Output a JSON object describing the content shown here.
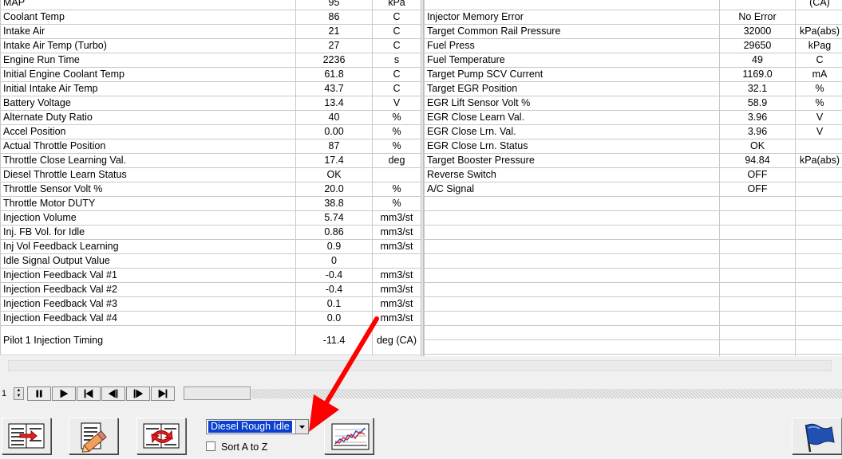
{
  "left_rows": [
    {
      "name": "MAP",
      "value": "95",
      "unit": "kPa"
    },
    {
      "name": "Coolant Temp",
      "value": "86",
      "unit": "C"
    },
    {
      "name": "Intake Air",
      "value": "21",
      "unit": "C"
    },
    {
      "name": "Intake Air Temp (Turbo)",
      "value": "27",
      "unit": "C"
    },
    {
      "name": "Engine Run Time",
      "value": "2236",
      "unit": "s"
    },
    {
      "name": "Initial Engine Coolant Temp",
      "value": "61.8",
      "unit": "C"
    },
    {
      "name": "Initial Intake Air Temp",
      "value": "43.7",
      "unit": "C"
    },
    {
      "name": "Battery Voltage",
      "value": "13.4",
      "unit": "V"
    },
    {
      "name": "Alternate Duty Ratio",
      "value": "40",
      "unit": "%"
    },
    {
      "name": "Accel Position",
      "value": "0.00",
      "unit": "%"
    },
    {
      "name": "Actual Throttle Position",
      "value": "87",
      "unit": "%"
    },
    {
      "name": "Throttle Close Learning Val.",
      "value": "17.4",
      "unit": "deg"
    },
    {
      "name": "Diesel Throttle Learn Status",
      "value": "OK",
      "unit": ""
    },
    {
      "name": "Throttle Sensor Volt %",
      "value": "20.0",
      "unit": "%"
    },
    {
      "name": "Throttle Motor DUTY",
      "value": "38.8",
      "unit": "%"
    },
    {
      "name": "Injection Volume",
      "value": "5.74",
      "unit": "mm3/st"
    },
    {
      "name": "Inj. FB Vol. for Idle",
      "value": "0.86",
      "unit": "mm3/st"
    },
    {
      "name": "Inj Vol Feedback Learning",
      "value": "0.9",
      "unit": "mm3/st"
    },
    {
      "name": "Idle Signal Output Value",
      "value": "0",
      "unit": ""
    },
    {
      "name": "Injection Feedback Val #1",
      "value": "-0.4",
      "unit": "mm3/st"
    },
    {
      "name": "Injection Feedback Val #2",
      "value": "-0.4",
      "unit": "mm3/st"
    },
    {
      "name": "Injection Feedback Val #3",
      "value": "0.1",
      "unit": "mm3/st"
    },
    {
      "name": "Injection Feedback Val #4",
      "value": "0.0",
      "unit": "mm3/st"
    },
    {
      "name": "Pilot 1 Injection Timing",
      "value": "-11.4",
      "unit": "deg (CA)"
    }
  ],
  "right_rows": [
    {
      "name": "",
      "value": "",
      "unit": "(CA)"
    },
    {
      "name": "Injector Memory Error",
      "value": "No Error",
      "unit": ""
    },
    {
      "name": "Target Common Rail Pressure",
      "value": "32000",
      "unit": "kPa(abs)"
    },
    {
      "name": "Fuel Press",
      "value": "29650",
      "unit": "kPag"
    },
    {
      "name": "Fuel Temperature",
      "value": "49",
      "unit": "C"
    },
    {
      "name": "Target Pump SCV Current",
      "value": "1169.0",
      "unit": "mA"
    },
    {
      "name": "Target EGR Position",
      "value": "32.1",
      "unit": "%"
    },
    {
      "name": "EGR Lift Sensor Volt %",
      "value": "58.9",
      "unit": "%"
    },
    {
      "name": "EGR Close Learn Val.",
      "value": "3.96",
      "unit": "V"
    },
    {
      "name": "EGR Close Lrn. Val.",
      "value": "3.96",
      "unit": "V"
    },
    {
      "name": "EGR Close Lrn. Status",
      "value": "OK",
      "unit": ""
    },
    {
      "name": "Target Booster Pressure",
      "value": "94.84",
      "unit": "kPa(abs)"
    },
    {
      "name": "Reverse Switch",
      "value": "OFF",
      "unit": ""
    },
    {
      "name": "A/C Signal",
      "value": "OFF",
      "unit": ""
    }
  ],
  "right_empty_rows": 12,
  "nav": {
    "page_number": "1"
  },
  "toolbar": {
    "selected_list": "Diesel Rough Idle",
    "sort_label": "Sort A to Z"
  },
  "colors": {
    "selection": "#0a3fd0",
    "annotation_arrow": "#ff0000"
  }
}
